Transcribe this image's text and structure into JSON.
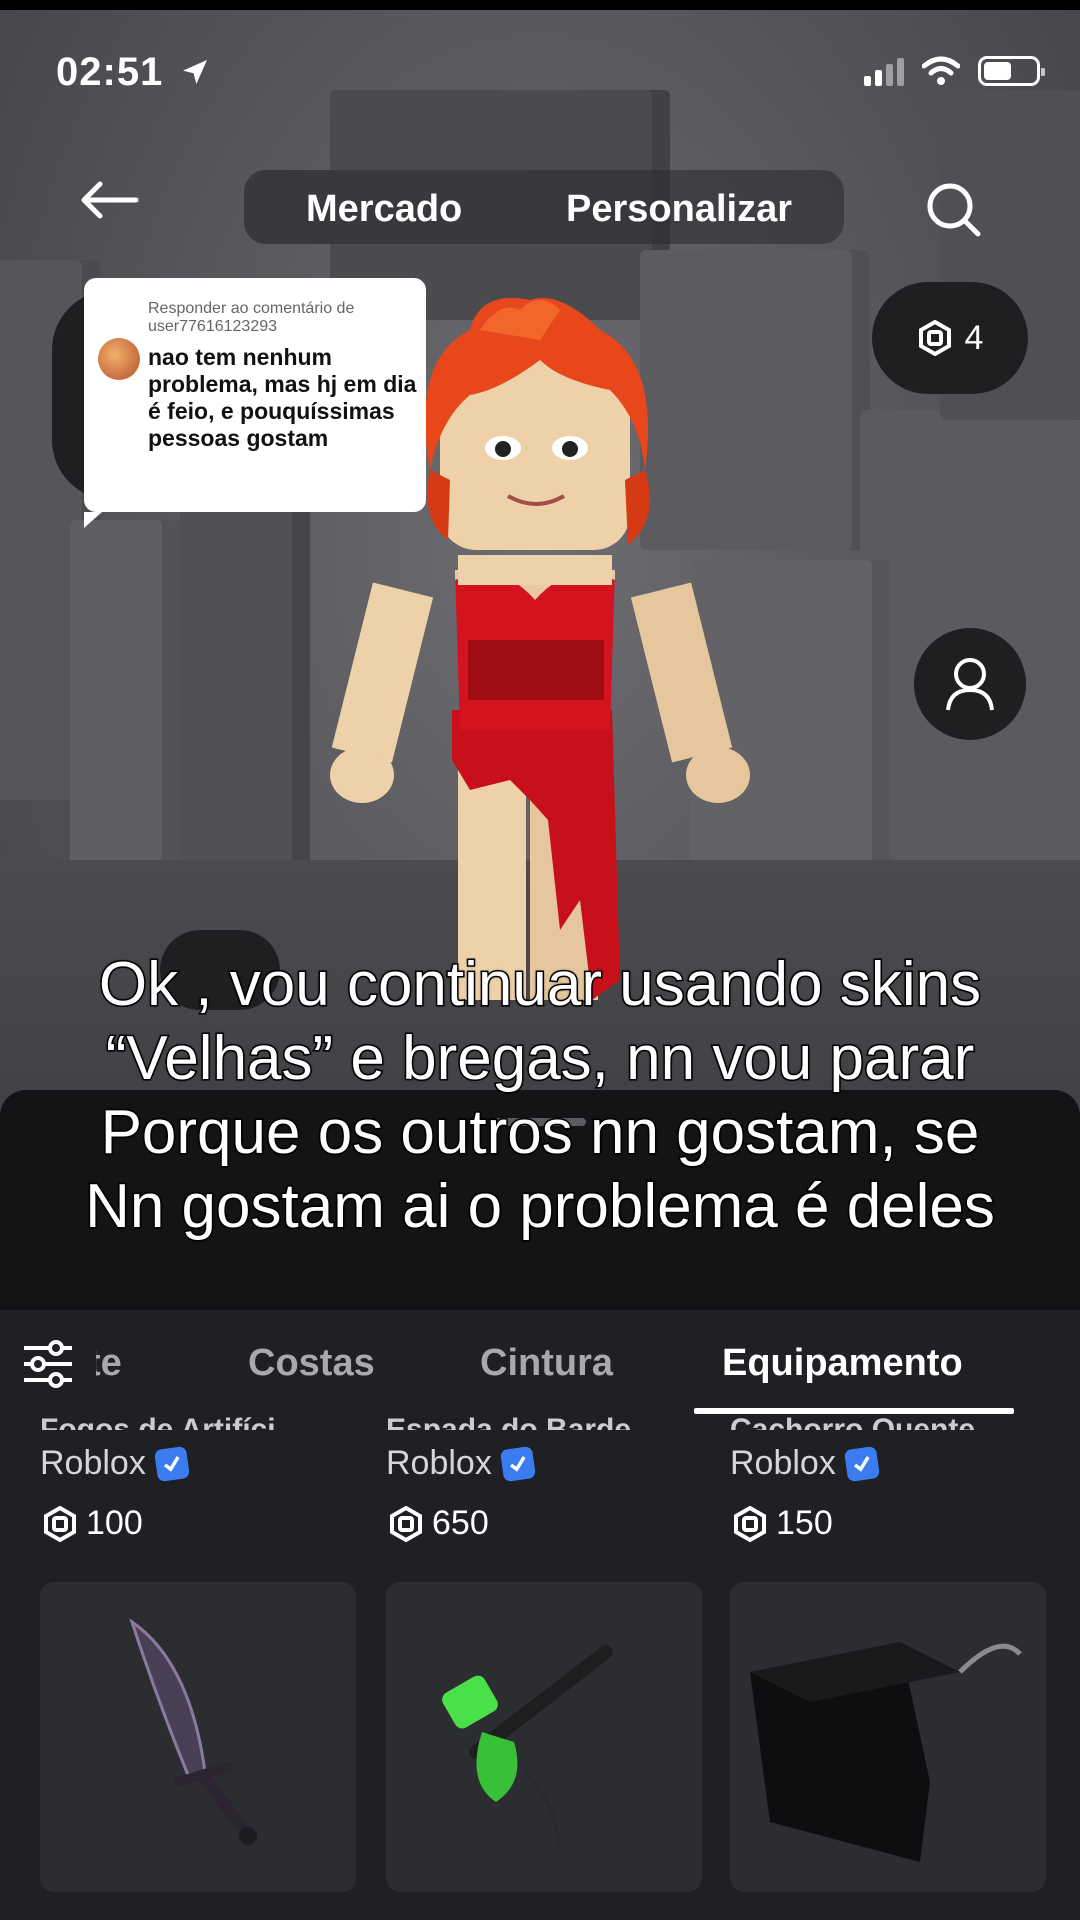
{
  "status_bar": {
    "time": "02:51"
  },
  "header": {
    "tabs": [
      {
        "label": "Mercado"
      },
      {
        "label": "Personalizar"
      }
    ]
  },
  "robux_balance": "4",
  "comment": {
    "reply_label": "Responder ao comentário de user77616123293",
    "text": "nao tem nenhum problema, mas hj em dia é feio, e pouquíssimas pessoas gostam"
  },
  "caption": {
    "lines": [
      "Ok , vou continuar usando skins",
      "“Velhas” e bregas, nn vou parar",
      "Porque os outros nn gostam, se",
      "Nn gostam ai o problema é deles"
    ]
  },
  "category_tabs": [
    {
      "label": "te"
    },
    {
      "label": "Costas"
    },
    {
      "label": "Cintura"
    },
    {
      "label": "Equipamento"
    }
  ],
  "items": [
    {
      "name": "Fogos de Artifíci...",
      "creator": "Roblox",
      "price": "100"
    },
    {
      "name": "Espada do Barde...",
      "creator": "Roblox",
      "price": "650"
    },
    {
      "name": "Cachorro Quente",
      "creator": "Roblox",
      "price": "150"
    }
  ],
  "cards": [
    {
      "icon": "sword-icon"
    },
    {
      "icon": "blaster-icon"
    },
    {
      "icon": "box-hat-icon"
    }
  ],
  "colors": {
    "accent": "#3b7cf0",
    "sheet": "#1f2023",
    "dress": "#c8101a",
    "hair": "#e8471c"
  }
}
